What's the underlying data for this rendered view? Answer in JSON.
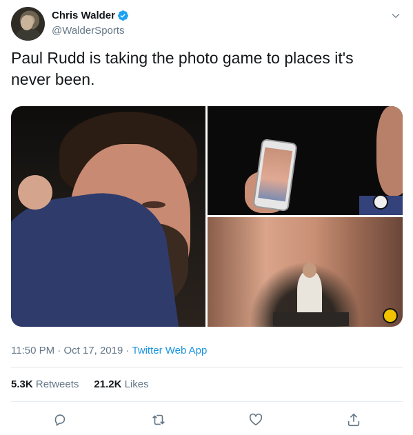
{
  "user": {
    "display_name": "Chris Walder",
    "handle": "@WalderSports",
    "verified": true,
    "avatar_icon": "avatar-photo"
  },
  "tweet": {
    "text": "Paul Rudd is taking the photo game to places it's never been.",
    "time": "11:50 PM",
    "date": "Oct 17, 2019",
    "separator": "·",
    "source": "Twitter Web App"
  },
  "stats": {
    "retweets_count": "5.3K",
    "retweets_label": "Retweets",
    "likes_count": "21.2K",
    "likes_label": "Likes"
  },
  "actions": [
    {
      "name": "reply",
      "icon": "reply-icon"
    },
    {
      "name": "retweet",
      "icon": "retweet-icon"
    },
    {
      "name": "like",
      "icon": "heart-icon"
    },
    {
      "name": "share",
      "icon": "share-icon"
    }
  ],
  "media": {
    "count": 3,
    "items": [
      "photo-closeup-face",
      "photo-holding-phone",
      "photo-phone-screen-view"
    ]
  },
  "colors": {
    "text": "#14171a",
    "secondary": "#657786",
    "link": "#1b95e0",
    "divider": "#e6ecf0",
    "verified_badge": "#1da1f2"
  }
}
